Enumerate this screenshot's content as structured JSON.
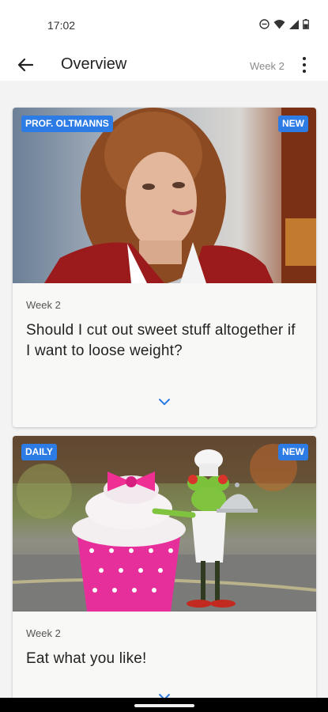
{
  "status_bar": {
    "time": "17:02"
  },
  "app_bar": {
    "title": "Overview",
    "week": "Week 2"
  },
  "cards": [
    {
      "badge_left": "PROF. OLTMANNS",
      "badge_right": "NEW",
      "week": "Week 2",
      "headline": "Should I cut out sweet stuff altogether if I want to loose weight?"
    },
    {
      "badge_left": "DAILY",
      "badge_right": "NEW",
      "week": "Week 2",
      "headline": "Eat what you like!"
    }
  ],
  "colors": {
    "badge": "#2d7be5",
    "chevron": "#2d7be5"
  }
}
